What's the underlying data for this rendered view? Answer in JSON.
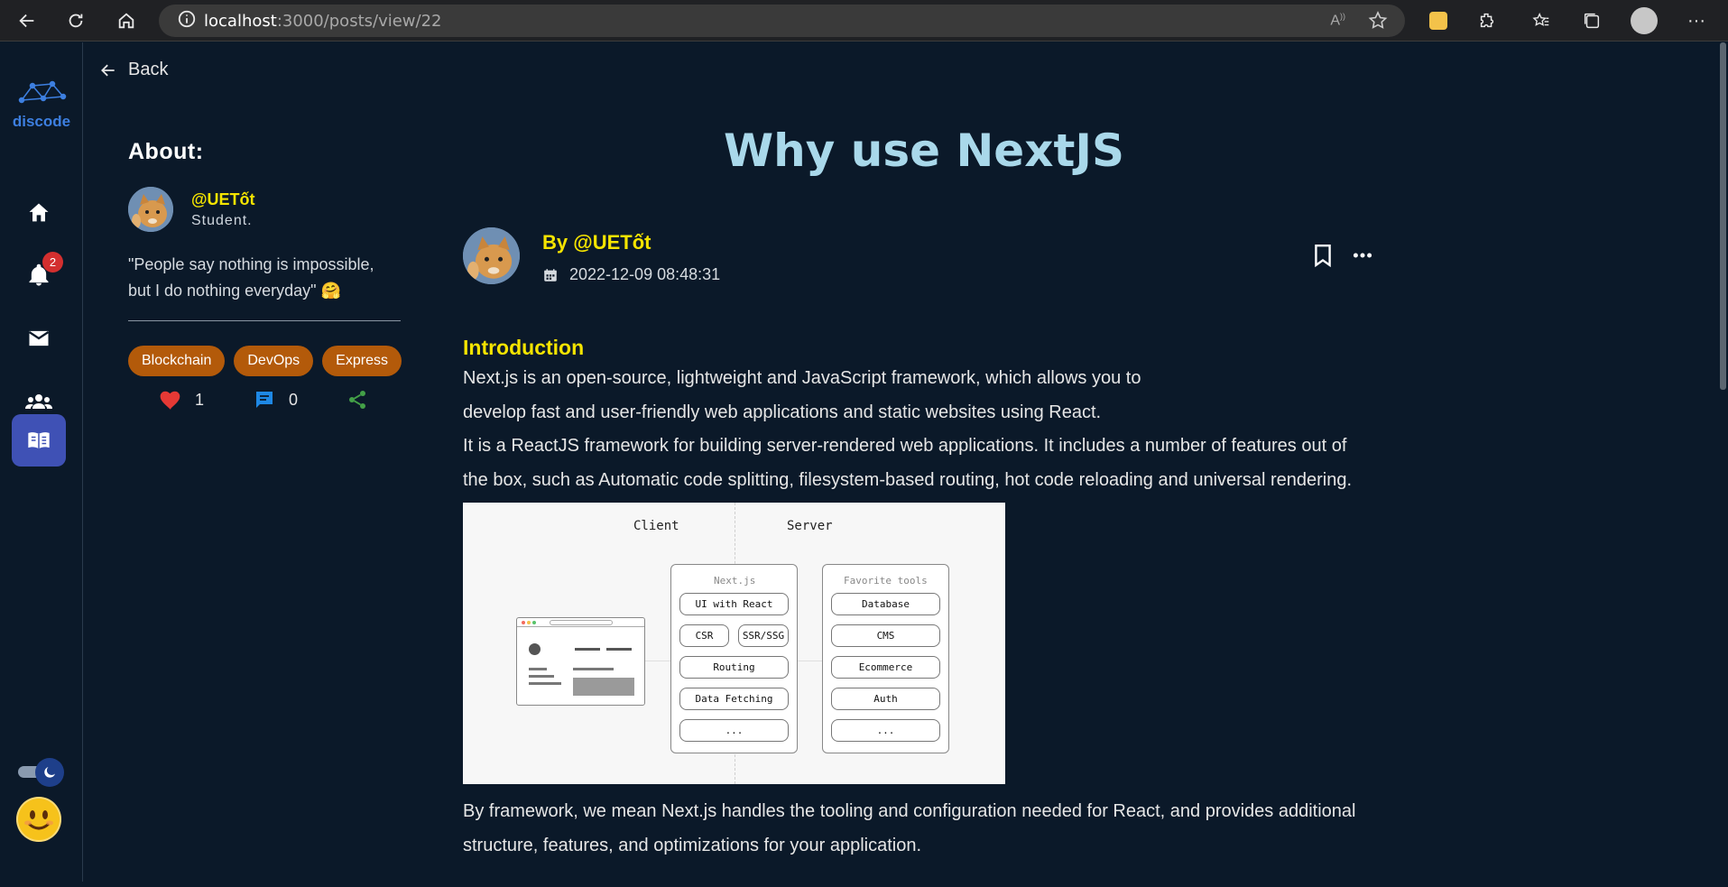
{
  "browser": {
    "url_host": "localhost",
    "url_rest": ":3000/posts/view/22"
  },
  "rail": {
    "logo_text": "discode",
    "notification_count": "2"
  },
  "back_label": "Back",
  "about": {
    "heading": "About:",
    "handle": "@UETốt",
    "role": "Student.",
    "quote": "\"People say nothing is impossible, but I do nothing everyday\" 🤗",
    "tags": [
      "Blockchain",
      "DevOps",
      "Express"
    ],
    "likes": "1",
    "comments": "0"
  },
  "post": {
    "title": "Why use NextJS",
    "by": "By @UETốt",
    "date": "2022-12-09 08:48:31",
    "section_heading": "Introduction",
    "paragraph1_line1": "Next.js is an open-source, lightweight and JavaScript framework, which allows you to",
    "paragraph1_line2": "develop fast and user-friendly web applications and static websites using React.",
    "paragraph2": "It is a ReactJS framework for building server-rendered web applications. It includes a number of features out of the box, such as Automatic code splitting, filesystem-based routing, hot code reloading and universal rendering.",
    "paragraph3": "By framework, we mean Next.js handles the tooling and configuration needed for React, and provides additional structure, features, and optimizations for your application."
  },
  "figure": {
    "client_label": "Client",
    "server_label": "Server",
    "nextjs_head": "Next.js",
    "tools_head": "Favorite tools",
    "nextjs_items": [
      "UI with React",
      "CSR",
      "SSR/SSG",
      "Routing",
      "Data Fetching",
      "..."
    ],
    "tools_items": [
      "Database",
      "CMS",
      "Ecommerce",
      "Auth",
      "..."
    ]
  },
  "colors": {
    "accent_title": "#a9d8ea",
    "handle_yellow": "#f5e400",
    "tag_orange": "#b35a0a",
    "active_nav": "#3f51b5",
    "bg": "#0b1929"
  }
}
